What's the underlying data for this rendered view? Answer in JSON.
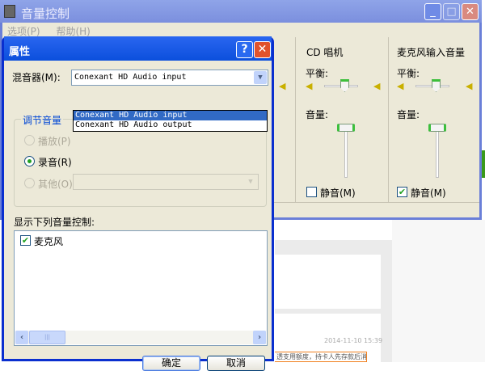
{
  "background": {
    "date": "2014-11-10  15:39",
    "note": "透支用额度，持卡人先存款后消费"
  },
  "main_window": {
    "title": "音量控制",
    "menu": [
      "选项(P)",
      "帮助(H)"
    ],
    "columns": [
      {
        "title": "CD 唱机",
        "balance_label": "平衡:",
        "volume_label": "音量:",
        "mute_label": "静音(M)",
        "muted": false,
        "volume_percent": 100,
        "balance": 0
      },
      {
        "title": "麦克风输入音量",
        "balance_label": "平衡:",
        "volume_label": "音量:",
        "mute_label": "静音(M)",
        "muted": true,
        "volume_percent": 100,
        "balance": 0
      }
    ]
  },
  "dialog": {
    "title": "属性",
    "mixer_label": "混音器(M):",
    "mixer_value": "Conexant HD Audio input",
    "mixer_options": [
      "Conexant HD Audio input",
      "Conexant HD Audio output"
    ],
    "group_title": "调节音量",
    "radios": [
      {
        "label": "播放(P)",
        "checked": false,
        "disabled": true
      },
      {
        "label": "录音(R)",
        "checked": true,
        "disabled": false
      },
      {
        "label": "其他(O)",
        "checked": false,
        "disabled": true
      }
    ],
    "list_label": "显示下列音量控制:",
    "list_items": [
      {
        "label": "麦克风",
        "checked": true
      }
    ],
    "ok": "确定",
    "cancel": "取消",
    "help": "?",
    "close": "✕"
  }
}
